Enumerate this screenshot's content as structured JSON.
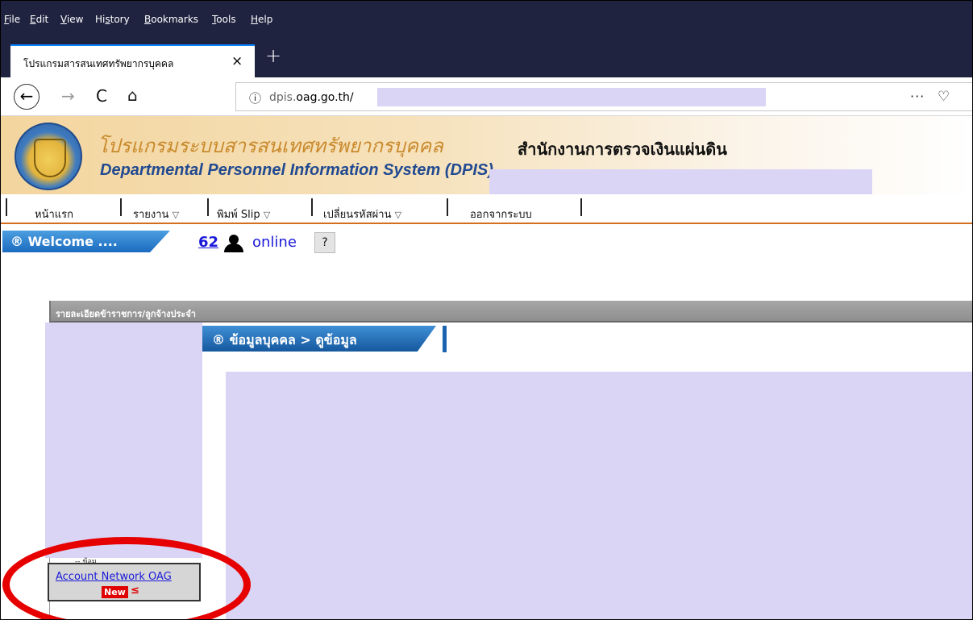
{
  "menubar": {
    "items": [
      "File",
      "Edit",
      "View",
      "History",
      "Bookmarks",
      "Tools",
      "Help"
    ]
  },
  "tab": {
    "title": "โปรแกรมสารสนเทศทรัพยากรบุคคล",
    "close_icon": "×",
    "newtab_icon": "+"
  },
  "toolbar": {
    "back_icon": "←",
    "forward_icon": "→",
    "reload_icon": "C",
    "home_icon": "⌂",
    "info_icon": "ⓘ",
    "url_prefix": "dpis.",
    "url_domain": "oag.go.th/",
    "more_icon": "···",
    "pocket_icon": "♡"
  },
  "banner": {
    "logo_thai": "โปรแกรมระบบสารสนเทศทรัพยากรบุคคล",
    "logo_eng": "Departmental Personnel Information System (DPIS)",
    "org_name": "สำนักงานการตรวจเงินแผ่นดิน"
  },
  "nav": {
    "items": [
      {
        "label": "หน้าแรก",
        "arrow": ""
      },
      {
        "label": "รายงาน",
        "arrow": "▽"
      },
      {
        "label": "พิมพ์ Slip",
        "arrow": "▽"
      },
      {
        "label": "เปลี่ยนรหัสผ่าน",
        "arrow": "▽"
      },
      {
        "label": "ออกจากระบบ",
        "arrow": ""
      }
    ]
  },
  "welcome": {
    "label": "® Welcome ....",
    "online_count": "62",
    "online_label": "online",
    "help_label": "?"
  },
  "content": {
    "section_title": "รายละเอียดข้าราชการ/ลูกจ้างประจำ",
    "breadcrumb": "® ข้อมูลบุคคล > ดูข้อมูล",
    "account_link": "Account Network OAG",
    "new_badge": "New",
    "partial_label": "-- ข้อมู"
  },
  "colors": {
    "chrome_dark": "#202340",
    "accent_blue": "#1b6bbf",
    "nav_orange": "#d46f20",
    "redaction": "#dad4f5",
    "highlight_red": "#e60000"
  }
}
